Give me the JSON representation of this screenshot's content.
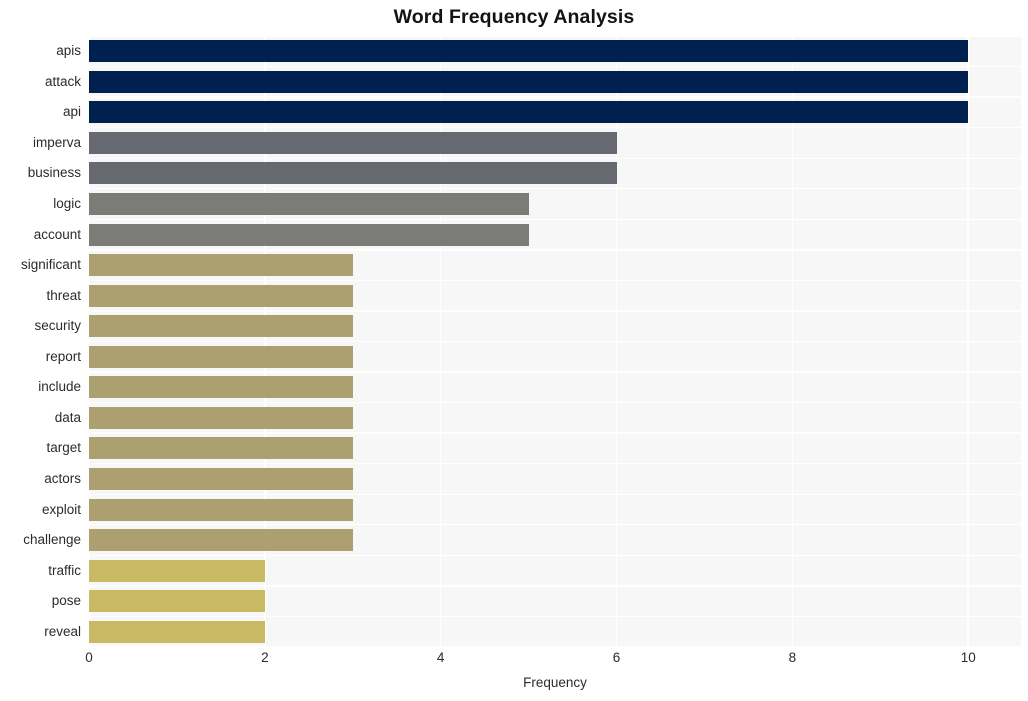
{
  "chart_data": {
    "type": "bar",
    "orientation": "horizontal",
    "title": "Word Frequency Analysis",
    "xlabel": "Frequency",
    "ylabel": "",
    "xlim": [
      0,
      10.6
    ],
    "xticks": [
      0,
      2,
      4,
      6,
      8,
      10
    ],
    "xtick_labels": [
      "0",
      "2",
      "4",
      "6",
      "8",
      "10"
    ],
    "grid": true,
    "grid_color": "#ffffff",
    "plot_background": "#f7f7f7",
    "figure_background": "#ffffff",
    "legend": null,
    "categories": [
      "apis",
      "attack",
      "api",
      "imperva",
      "business",
      "logic",
      "account",
      "significant",
      "threat",
      "security",
      "report",
      "include",
      "data",
      "target",
      "actors",
      "exploit",
      "challenge",
      "traffic",
      "pose",
      "reveal"
    ],
    "values": [
      10,
      10,
      10,
      6,
      6,
      5,
      5,
      3,
      3,
      3,
      3,
      3,
      3,
      3,
      3,
      3,
      3,
      2,
      2,
      2
    ],
    "bar_colors": [
      "#002050",
      "#002050",
      "#002050",
      "#676970",
      "#676970",
      "#7b7b78",
      "#7b7b78",
      "#aca070",
      "#aca070",
      "#aca070",
      "#aca070",
      "#aca070",
      "#aca070",
      "#aca070",
      "#aca070",
      "#aca070",
      "#aca070",
      "#c8b964",
      "#c8b964",
      "#c8b964"
    ]
  }
}
